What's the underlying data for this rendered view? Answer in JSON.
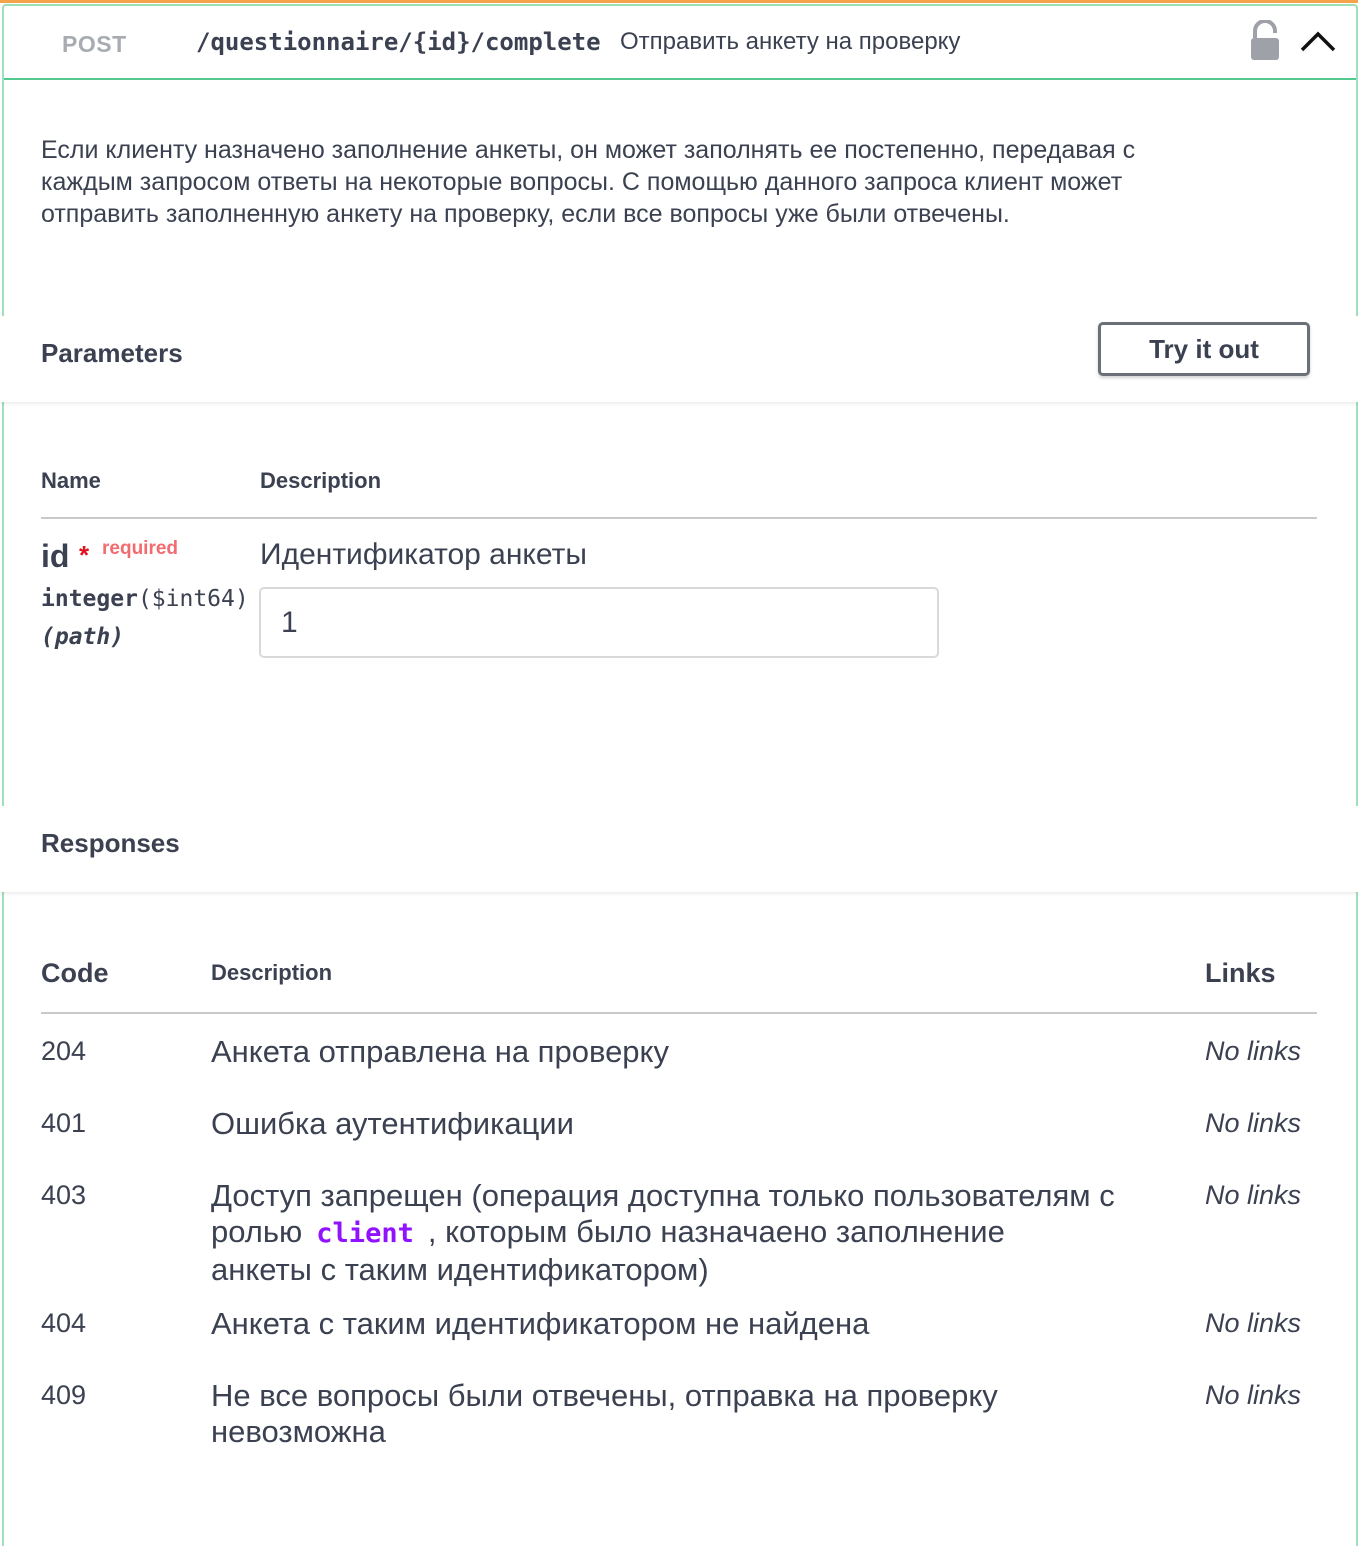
{
  "operation": {
    "method": "POST",
    "path": "/questionnaire/{id}/complete",
    "summary": "Отправить анкету на проверку",
    "description_lines": [
      "Если клиенту назначено заполнение анкеты, он может заполнять ее постепенно, передавая с",
      "каждым запросом ответы на некоторые вопросы. С помощью данного запроса клиент может",
      "отправить заполненную анкету на проверку, если все вопросы уже были отвечены."
    ],
    "lock_icon": "lock-icon",
    "collapse_icon": "chevron-up-icon"
  },
  "parameters": {
    "title": "Parameters",
    "try_button": "Try it out",
    "col_name": "Name",
    "col_description": "Description",
    "items": [
      {
        "name": "id",
        "required_star": "*",
        "required_label": "required",
        "type": "integer",
        "format": "($int64)",
        "in": "(path)",
        "description": "Идентификатор анкеты",
        "value": "1"
      }
    ]
  },
  "responses": {
    "title": "Responses",
    "col_code": "Code",
    "col_description": "Description",
    "col_links": "Links",
    "rows": [
      {
        "code": "204",
        "description": "Анкета отправлена на проверку",
        "links": "No links"
      },
      {
        "code": "401",
        "description": "Ошибка аутентификации",
        "links": "No links"
      },
      {
        "code": "403",
        "description_part1": "Доступ запрещен (операция доступна только пользователям с",
        "description_part2_before": "ролью",
        "description_code": "client",
        "description_part2_after": ", которым было назначаено заполнение",
        "description_part3": "анкеты с таким идентификатором)",
        "links": "No links"
      },
      {
        "code": "404",
        "description": "Анкета с таким идентификатором не найдена",
        "links": "No links"
      },
      {
        "code": "409",
        "description_line1": "Не все вопросы были отвечены, отправка на проверку",
        "description_line2": "невозможна",
        "links": "No links"
      }
    ]
  },
  "colors": {
    "accent_orange": "#f3a44c",
    "post_border": "#55c98d",
    "required": "#f26b6f",
    "inline_code": "#9012fe"
  }
}
